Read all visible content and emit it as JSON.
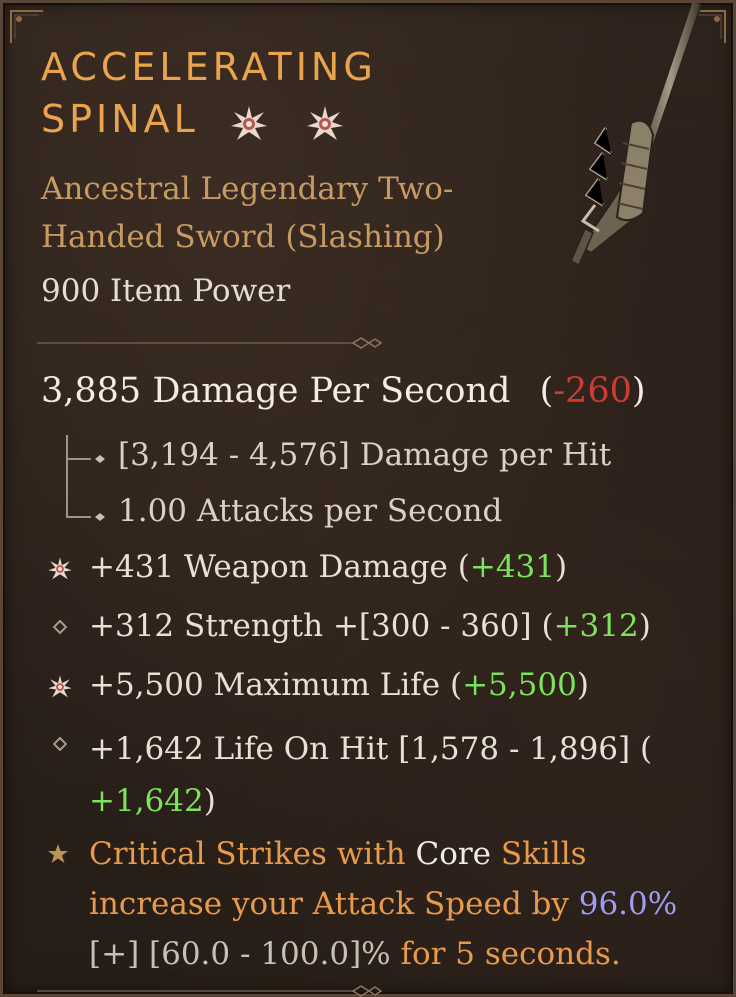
{
  "item": {
    "name_line1": "ACCELERATING",
    "name_line2": "SPINAL",
    "type_line1": "Ancestral Legendary Two-",
    "type_line2": "Handed Sword (Slashing)",
    "item_power": "900 Item Power",
    "icon": "two-handed-sword"
  },
  "dps": {
    "text": "3,885 Damage Per Second",
    "paren_open": "(",
    "delta": "-260",
    "paren_close": ")"
  },
  "weapon_details": [
    "[3,194 - 4,576] Damage per Hit",
    "1.00 Attacks per Second"
  ],
  "stats": {
    "weapon_damage": {
      "text": "+431 Weapon Damage (",
      "delta": "+431",
      "close": ")",
      "icon": "greater-affix-icon"
    },
    "strength": {
      "text": "+312 Strength +[300 - 360] (",
      "delta": "+312",
      "close": ")",
      "icon": "diamond-icon"
    },
    "max_life": {
      "text": "+5,500 Maximum Life (",
      "delta": "+5,500",
      "close": ")",
      "icon": "greater-affix-icon"
    },
    "life_on_hit": {
      "text": "+1,642 Life On Hit [1,578 - 1,896] (",
      "delta": "+1,642",
      "close": ")",
      "icon": "diamond-icon"
    }
  },
  "aspect": {
    "icon": "star-icon",
    "part1": "Critical Strikes with ",
    "core": "Core",
    "part2": " Skills increase your Attack Speed by ",
    "value": "96.0%",
    "range": "[+] [60.0 - 100.0]%",
    "part3": " for 5 seconds."
  },
  "colors": {
    "title": "#e9a44d",
    "legendary": "#c79a63",
    "negative": "#cf3b33",
    "positive": "#7ce35a",
    "aspect_value": "#9c9df3"
  }
}
